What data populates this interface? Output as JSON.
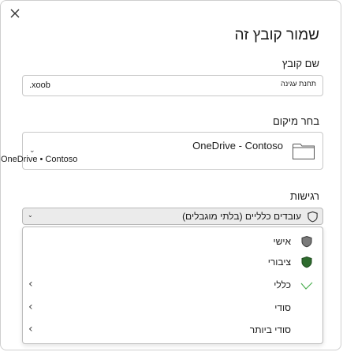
{
  "dialog": {
    "close_glyph": "✕",
    "title": "שמור קובץ זה"
  },
  "file_name": {
    "label": "שם קובץ",
    "value": "תחנת עגינה",
    "extension": ".xoob"
  },
  "location": {
    "label": "בחר מיקום",
    "primary": "OneDrive - Contoso",
    "secondary": "OneDrive • Contoso",
    "chevron": "⌄"
  },
  "sensitivity": {
    "label": "רגישות",
    "selected": "עובדים כלליים (בלתי מוגבלים)",
    "chevron": "⌄",
    "options": [
      {
        "label": "אישי",
        "icon": "shield-gray-icon",
        "arrow": ""
      },
      {
        "label": "ציבורי",
        "icon": "shield-green-icon",
        "arrow": ""
      },
      {
        "label": "כללי",
        "icon": "checkmark-icon",
        "arrow": "‹"
      },
      {
        "label": "סודי",
        "icon": "",
        "arrow": "‹"
      },
      {
        "label": "סודי ביותר",
        "icon": "",
        "arrow": "‹"
      }
    ]
  },
  "colors": {
    "shield_gray": "#7a7a7a",
    "shield_green": "#2e6b2e",
    "check_green": "#4caf50",
    "select_bg": "#ebebeb"
  }
}
